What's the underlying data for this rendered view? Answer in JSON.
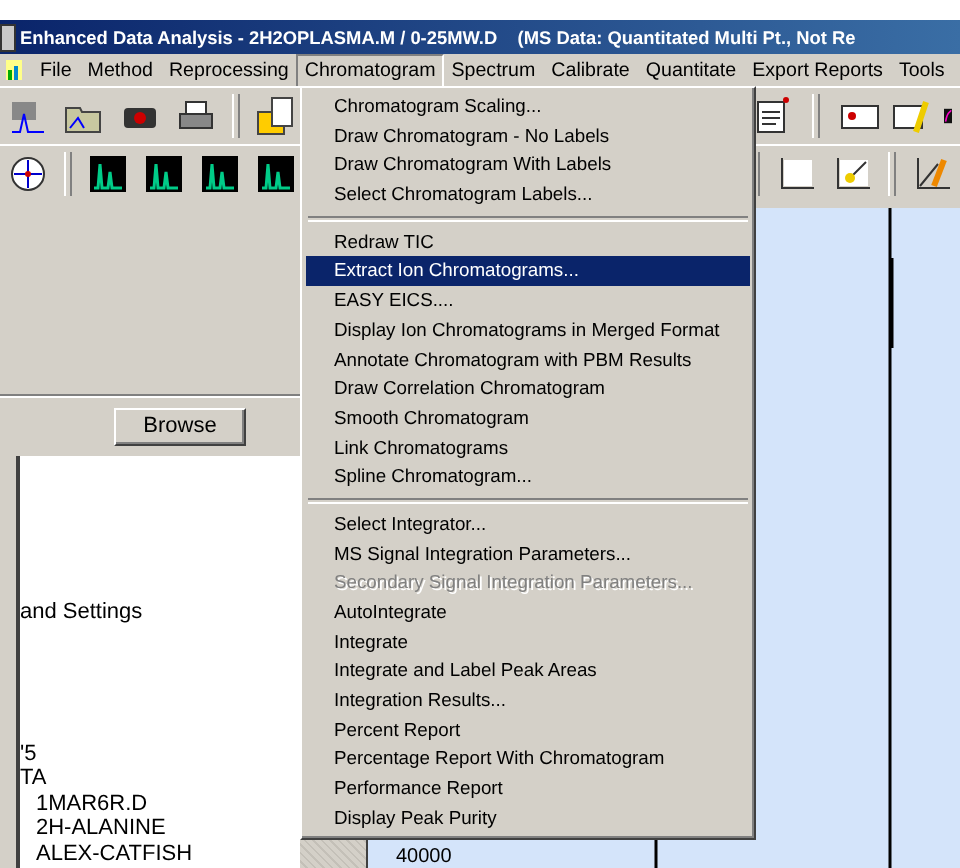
{
  "window": {
    "title": "Enhanced Data Analysis - 2H2OPLASMA.M / 0-25MW.D    (MS Data: Quantitated Multi Pt., Not Re"
  },
  "menu_bar": [
    {
      "label": "File",
      "selected": false
    },
    {
      "label": "Method",
      "selected": false
    },
    {
      "label": "Reprocessing",
      "selected": false
    },
    {
      "label": "Chromatogram",
      "selected": true
    },
    {
      "label": "Spectrum",
      "selected": false
    },
    {
      "label": "Calibrate",
      "selected": false
    },
    {
      "label": "Quantitate",
      "selected": false
    },
    {
      "label": "Export Reports",
      "selected": false
    },
    {
      "label": "Tools",
      "selected": false
    }
  ],
  "chromatogram_menu": [
    {
      "kind": "item",
      "label": "Chromatogram Scaling...",
      "disabled": false,
      "selected": false
    },
    {
      "kind": "item",
      "label": "Draw Chromatogram - No Labels",
      "disabled": false,
      "selected": false
    },
    {
      "kind": "item",
      "label": "Draw Chromatogram With Labels",
      "disabled": false,
      "selected": false
    },
    {
      "kind": "item",
      "label": "Select Chromatogram Labels...",
      "disabled": false,
      "selected": false
    },
    {
      "kind": "separator"
    },
    {
      "kind": "item",
      "label": "Redraw TIC",
      "disabled": false,
      "selected": false
    },
    {
      "kind": "item",
      "label": "Extract Ion Chromatograms...",
      "disabled": false,
      "selected": true
    },
    {
      "kind": "item",
      "label": "EASY EICS....",
      "disabled": false,
      "selected": false
    },
    {
      "kind": "item",
      "label": "Display Ion Chromatograms in Merged Format",
      "disabled": false,
      "selected": false
    },
    {
      "kind": "item",
      "label": "Annotate Chromatogram with PBM Results",
      "disabled": false,
      "selected": false
    },
    {
      "kind": "item",
      "label": "Draw Correlation Chromatogram",
      "disabled": false,
      "selected": false
    },
    {
      "kind": "item",
      "label": "Smooth Chromatogram",
      "disabled": false,
      "selected": false
    },
    {
      "kind": "item",
      "label": "Link Chromatograms",
      "disabled": false,
      "selected": false
    },
    {
      "kind": "item",
      "label": "Spline Chromatogram...",
      "disabled": false,
      "selected": false
    },
    {
      "kind": "separator"
    },
    {
      "kind": "item",
      "label": "Select Integrator...",
      "disabled": false,
      "selected": false
    },
    {
      "kind": "item",
      "label": "MS Signal Integration Parameters...",
      "disabled": false,
      "selected": false
    },
    {
      "kind": "item",
      "label": "Secondary Signal Integration Parameters...",
      "disabled": true,
      "selected": false
    },
    {
      "kind": "item",
      "label": "AutoIntegrate",
      "disabled": false,
      "selected": false
    },
    {
      "kind": "item",
      "label": "Integrate",
      "disabled": false,
      "selected": false
    },
    {
      "kind": "item",
      "label": "Integrate and Label Peak Areas",
      "disabled": false,
      "selected": false
    },
    {
      "kind": "item",
      "label": "Integration Results...",
      "disabled": false,
      "selected": false
    },
    {
      "kind": "item",
      "label": "Percent Report",
      "disabled": false,
      "selected": false
    },
    {
      "kind": "item",
      "label": "Percentage Report With Chromatogram",
      "disabled": false,
      "selected": false
    },
    {
      "kind": "item",
      "label": "Performance Report",
      "disabled": false,
      "selected": false
    },
    {
      "kind": "item",
      "label": "Display Peak Purity",
      "disabled": false,
      "selected": false
    }
  ],
  "browse_button": "Browse",
  "file_tree": [
    {
      "label": "and Settings"
    },
    {
      "label": "'5"
    },
    {
      "label": "TA",
      "children": [
        {
          "label": "1MAR6R.D"
        },
        {
          "label": "2H-ALANINE"
        },
        {
          "label": "ALEX-CATFISH"
        }
      ]
    }
  ],
  "chart": {
    "y_tick": "40000"
  }
}
